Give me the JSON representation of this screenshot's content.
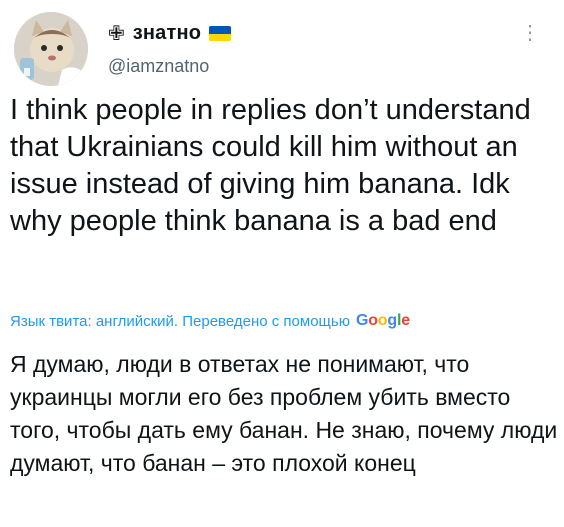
{
  "tweet": {
    "author": {
      "emoji": "✙",
      "display_name": "знатно",
      "handle": "@iamznatno",
      "flag_colors": {
        "top": "#0057b7",
        "bottom": "#ffd700"
      }
    },
    "more_icon": "more-vertical-icon",
    "text_original": "I think people in replies don’t understand that Ukrainians could kill him without an issue instead of giving him banana. Idk why people think banana is a bad end",
    "translation_label": "Язык твита: английский. Переведено с помощью",
    "translation_brand": "Google",
    "text_translated": "Я думаю, люди в ответах не понимают, что украинцы могли его без проблем убить вместо того, чтобы дать ему банан. Не знаю, почему люди думают, что банан – это плохой конец"
  },
  "colors": {
    "link": "#1d9bf0",
    "secondary_text": "#536471",
    "primary_text": "#0f1419"
  }
}
